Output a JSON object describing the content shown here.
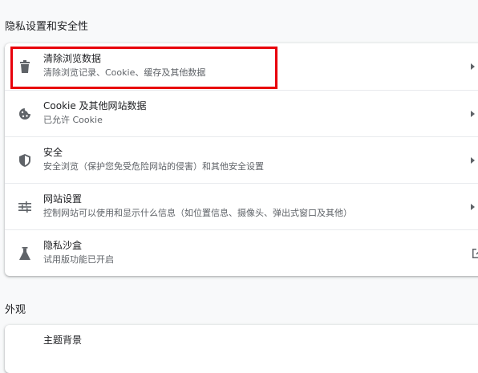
{
  "privacy_section": {
    "title": "隐私设置和安全性",
    "items": [
      {
        "label": "清除浏览数据",
        "sublabel": "清除浏览记录、Cookie、缓存及其他数据",
        "icon": "trash-icon",
        "action": "chevron"
      },
      {
        "label": "Cookie 及其他网站数据",
        "sublabel": "已允许 Cookie",
        "icon": "cookie-icon",
        "action": "chevron"
      },
      {
        "label": "安全",
        "sublabel": "安全浏览（保护您免受危险网站的侵害）和其他安全设置",
        "icon": "shield-icon",
        "action": "chevron"
      },
      {
        "label": "网站设置",
        "sublabel": "控制网站可以使用和显示什么信息（如位置信息、摄像头、弹出式窗口及其他）",
        "icon": "tune-icon",
        "action": "chevron"
      },
      {
        "label": "隐私沙盒",
        "sublabel": "试用版功能已开启",
        "icon": "flask-icon",
        "action": "external"
      }
    ]
  },
  "appearance_section": {
    "title": "外观",
    "items": [
      {
        "label": "主题背景"
      }
    ]
  },
  "colors": {
    "highlight_border": "#e8000b",
    "icon": "#5f6368",
    "text_primary": "#202124",
    "text_secondary": "#5f6368"
  }
}
